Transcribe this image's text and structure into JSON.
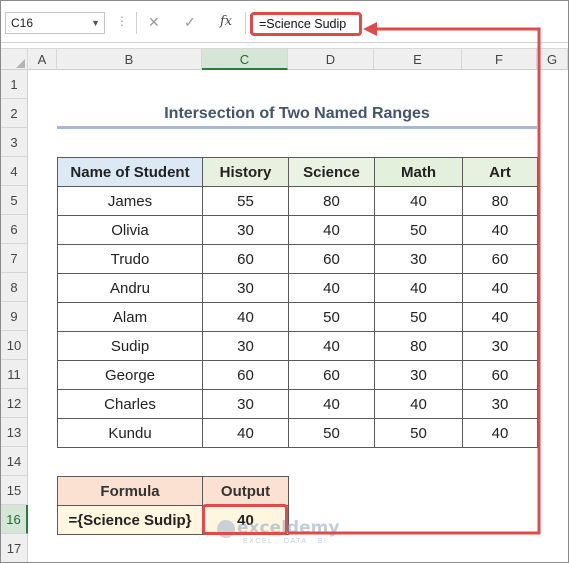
{
  "formula_bar": {
    "name_box": "C16",
    "cancel_icon": "✕",
    "enter_icon": "✓",
    "fx_label": "fx",
    "formula": "=Science Sudip"
  },
  "columns": [
    "A",
    "B",
    "C",
    "D",
    "E",
    "F",
    "G"
  ],
  "selected_column": "C",
  "rows": [
    "1",
    "2",
    "3",
    "4",
    "5",
    "6",
    "7",
    "8",
    "9",
    "10",
    "11",
    "12",
    "13",
    "14",
    "15",
    "16",
    "17"
  ],
  "selected_row": "16",
  "sheet": {
    "title": "Intersection of Two Named Ranges",
    "table": {
      "headers": [
        "Name of Student",
        "History",
        "Science",
        "Math",
        "Art"
      ],
      "rows": [
        [
          "James",
          "55",
          "80",
          "40",
          "80"
        ],
        [
          "Olivia",
          "30",
          "40",
          "50",
          "40"
        ],
        [
          "Trudo",
          "60",
          "60",
          "30",
          "60"
        ],
        [
          "Andru",
          "30",
          "40",
          "40",
          "40"
        ],
        [
          "Alam",
          "40",
          "50",
          "50",
          "40"
        ],
        [
          "Sudip",
          "30",
          "40",
          "80",
          "30"
        ],
        [
          "George",
          "60",
          "60",
          "30",
          "60"
        ],
        [
          "Charles",
          "30",
          "40",
          "40",
          "30"
        ],
        [
          "Kundu",
          "40",
          "50",
          "50",
          "40"
        ]
      ]
    },
    "formula_table": {
      "headers": [
        "Formula",
        "Output"
      ],
      "formula_text": "={Science Sudip}",
      "output": "40"
    }
  },
  "watermark": {
    "brand": "exceldemy",
    "tagline": "EXCEL · DATA · BI"
  },
  "colors": {
    "highlight": "#e04a4a",
    "title": "#44546a",
    "selection": "#2b7a3f"
  }
}
